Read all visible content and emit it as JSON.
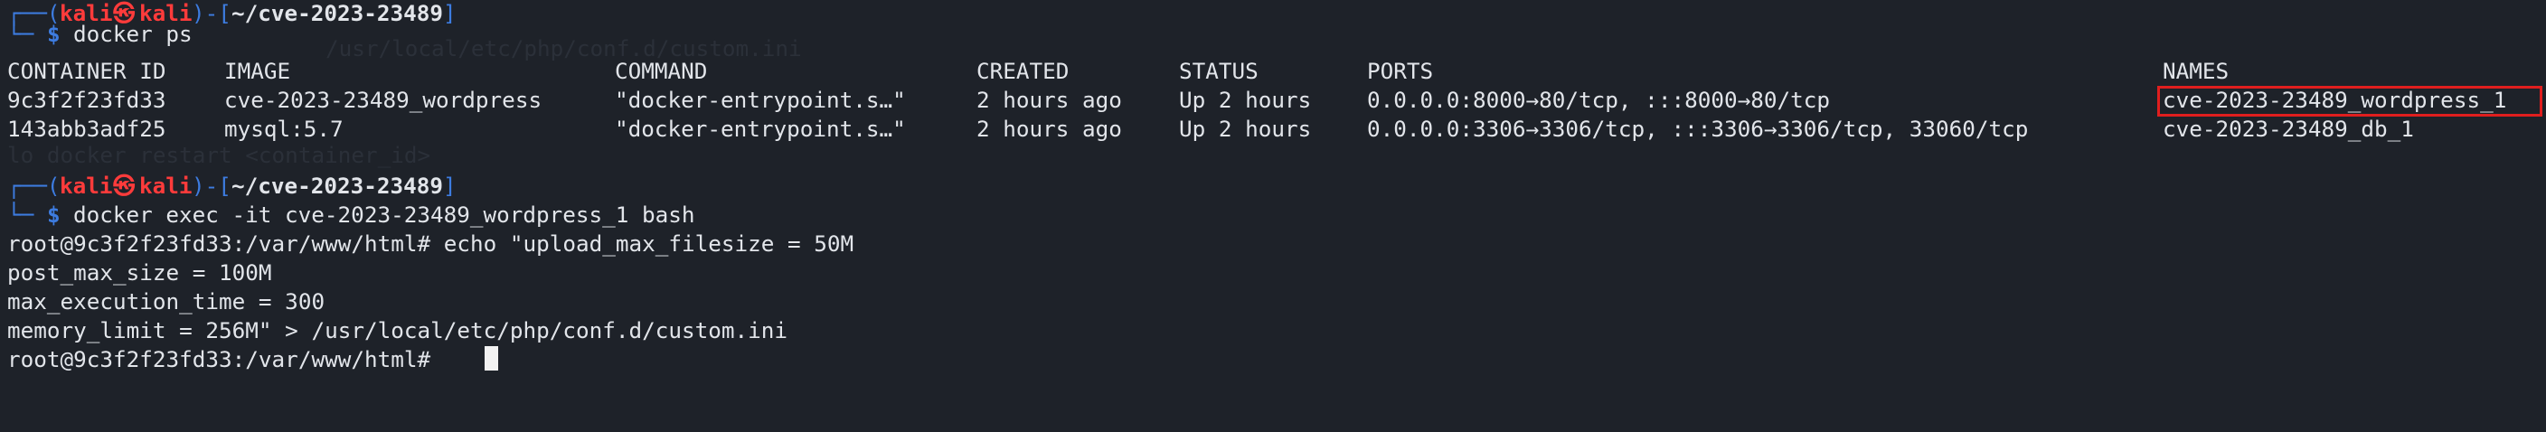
{
  "prompt": {
    "top_left": "┌──(",
    "user": "kali",
    "at": "㉿",
    "host": "kali",
    "mid": ")-[",
    "path": "~/cve-2023-23489",
    "close": "]",
    "bottom_left": "└─",
    "dollar": "$"
  },
  "commands": {
    "first": "docker ps",
    "second": "docker exec -it cve-2023-23489_wordpress_1 bash"
  },
  "table": {
    "headers": {
      "container_id": "CONTAINER ID",
      "image": "IMAGE",
      "command": "COMMAND",
      "created": "CREATED",
      "status": "STATUS",
      "ports": "PORTS",
      "names": "NAMES"
    },
    "rows": [
      {
        "container_id": "9c3f2f23fd33",
        "image": "cve-2023-23489_wordpress",
        "command": "\"docker-entrypoint.s…\"",
        "created": "2 hours ago",
        "status": "Up 2 hours",
        "ports": "0.0.0.0:8000→80/tcp, :::8000→80/tcp",
        "names": "cve-2023-23489_wordpress_1"
      },
      {
        "container_id": "143abb3adf25",
        "image": "mysql:5.7",
        "command": "\"docker-entrypoint.s…\"",
        "created": "2 hours ago",
        "status": "Up 2 hours",
        "ports": "0.0.0.0:3306→3306/tcp, :::3306→3306/tcp, 33060/tcp",
        "names": "cve-2023-23489_db_1"
      }
    ]
  },
  "shell": {
    "lines": [
      "root@9c3f2f23fd33:/var/www/html# echo \"upload_max_filesize = 50M",
      "post_max_size = 100M",
      "max_execution_time = 300",
      "memory_limit = 256M\" > /usr/local/etc/php/conf.d/custom.ini",
      "root@9c3f2f23fd33:/var/www/html# "
    ]
  },
  "colors": {
    "background": "#1e2229",
    "prompt_blue": "#3d7ce0",
    "prompt_red": "#ff3b3b",
    "text": "#e2e5ea",
    "highlight_box": "#e01e1e"
  }
}
